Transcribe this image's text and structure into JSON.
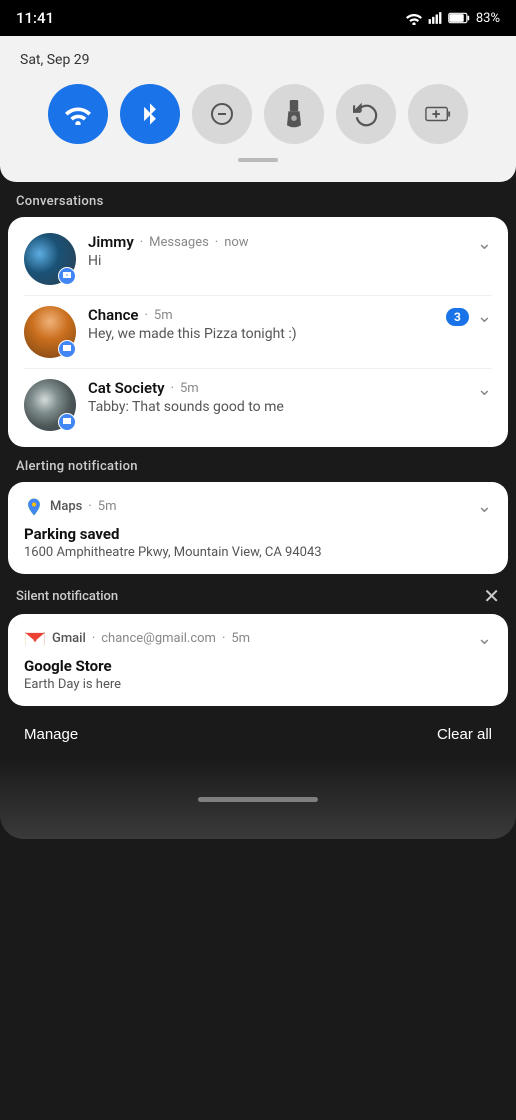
{
  "statusBar": {
    "time": "11:41",
    "battery": "83%",
    "icons": {
      "wifi": "▲",
      "signal": "▲",
      "battery": "🔋"
    }
  },
  "quickSettings": {
    "date": "Sat, Sep 29",
    "toggles": [
      {
        "id": "wifi",
        "label": "WiFi",
        "active": true,
        "symbol": "wifi"
      },
      {
        "id": "bluetooth",
        "label": "Bluetooth",
        "active": true,
        "symbol": "bt"
      },
      {
        "id": "dnd",
        "label": "Do Not Disturb",
        "active": false,
        "symbol": "⊖"
      },
      {
        "id": "flashlight",
        "label": "Flashlight",
        "active": false,
        "symbol": "flashlight"
      },
      {
        "id": "rotate",
        "label": "Auto Rotate",
        "active": false,
        "symbol": "rotate"
      },
      {
        "id": "battery_saver",
        "label": "Battery Saver",
        "active": false,
        "symbol": "battery+"
      }
    ]
  },
  "sections": {
    "conversations": {
      "label": "Conversations",
      "items": [
        {
          "id": "jimmy",
          "name": "Jimmy",
          "app": "Messages",
          "time": "now",
          "message": "Hi",
          "badge": null,
          "avatarClass": "jimmy-avatar"
        },
        {
          "id": "chance",
          "name": "Chance",
          "app": null,
          "time": "5m",
          "message": "Hey, we made this Pizza tonight :)",
          "badge": "3",
          "avatarClass": "chance-avatar"
        },
        {
          "id": "cat-society",
          "name": "Cat Society",
          "app": null,
          "time": "5m",
          "message": "Tabby: That sounds good to me",
          "badge": null,
          "avatarClass": "cat-avatar"
        }
      ]
    },
    "alerting": {
      "label": "Alerting notification",
      "items": [
        {
          "id": "maps-notif",
          "appName": "Maps",
          "time": "5m",
          "title": "Parking saved",
          "body": "1600 Amphitheatre Pkwy, Mountain View, CA 94043",
          "appIconType": "maps"
        }
      ]
    },
    "silent": {
      "label": "Silent notification",
      "closeButton": "✕",
      "items": [
        {
          "id": "gmail-notif",
          "appName": "Gmail",
          "email": "chance@gmail.com",
          "time": "5m",
          "title": "Google Store",
          "body": "Earth Day is here",
          "appIconType": "gmail"
        }
      ]
    }
  },
  "bottomBar": {
    "manage": "Manage",
    "clearAll": "Clear all"
  }
}
